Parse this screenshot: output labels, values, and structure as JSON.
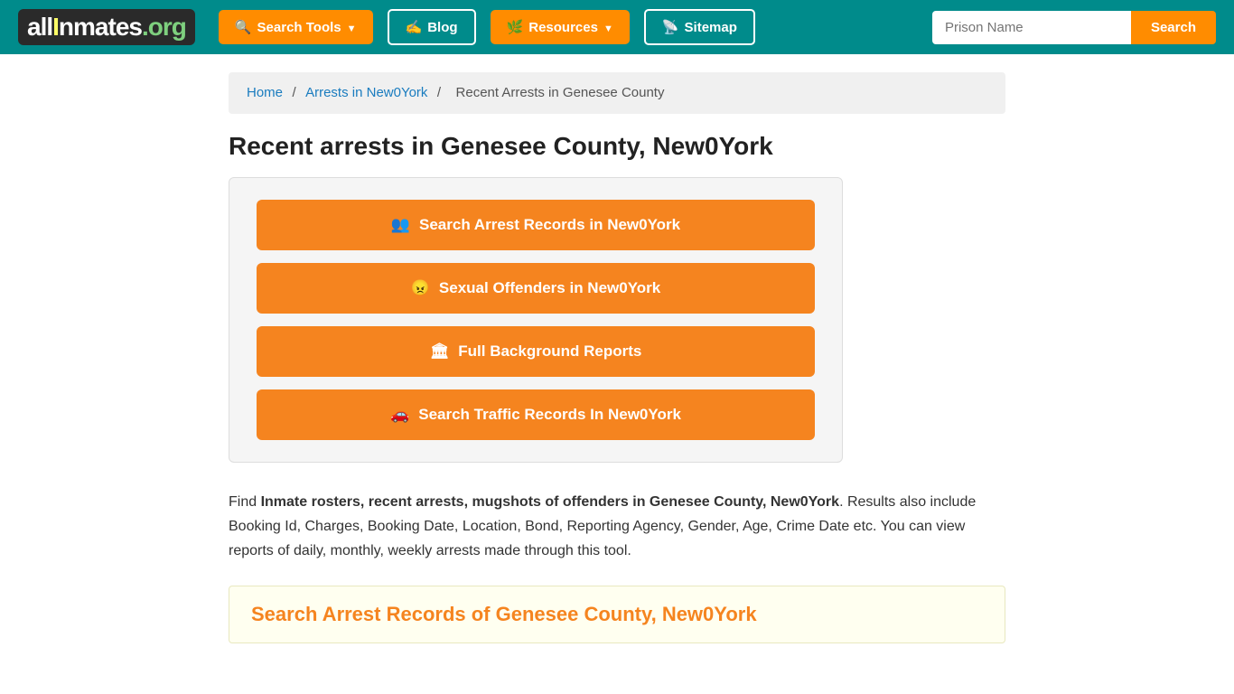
{
  "header": {
    "logo": {
      "all": "all",
      "inmates": "Inmates",
      "org": ".org"
    },
    "nav": [
      {
        "id": "search-tools",
        "label": "Search Tools",
        "hasDropdown": true,
        "icon": "search-icon"
      },
      {
        "id": "blog",
        "label": "Blog",
        "hasDropdown": false,
        "icon": "blog-icon"
      },
      {
        "id": "resources",
        "label": "Resources",
        "hasDropdown": true,
        "icon": "resources-icon"
      },
      {
        "id": "sitemap",
        "label": "Sitemap",
        "hasDropdown": false,
        "icon": "sitemap-icon"
      }
    ],
    "search": {
      "placeholder": "Prison Name",
      "button_label": "Search"
    }
  },
  "breadcrumb": {
    "home": "Home",
    "separator1": "/",
    "arrests": "Arrests in New0York",
    "separator2": "/",
    "current": "Recent Arrests in Genesee County"
  },
  "page": {
    "title": "Recent arrests in Genesee County, New0York",
    "buttons": [
      {
        "id": "arrest-records",
        "label": "Search Arrest Records in New0York",
        "icon": "people-icon"
      },
      {
        "id": "sex-offenders",
        "label": "Sexual Offenders in New0York",
        "icon": "offender-icon"
      },
      {
        "id": "background-reports",
        "label": "Full Background Reports",
        "icon": "building-icon"
      },
      {
        "id": "traffic-records",
        "label": "Search Traffic Records In New0York",
        "icon": "car-icon"
      }
    ],
    "description": {
      "prefix": "Find ",
      "bold1": "Inmate rosters, recent arrests, mugshots of offenders in Genesee County, New0York",
      "suffix": ". Results also include Booking Id, Charges, Booking Date, Location, Bond, Reporting Agency, Gender, Age, Crime Date etc. You can view reports of daily, monthly, weekly arrests made through this tool."
    },
    "section_heading": "Search Arrest Records of Genesee County, New0York"
  }
}
